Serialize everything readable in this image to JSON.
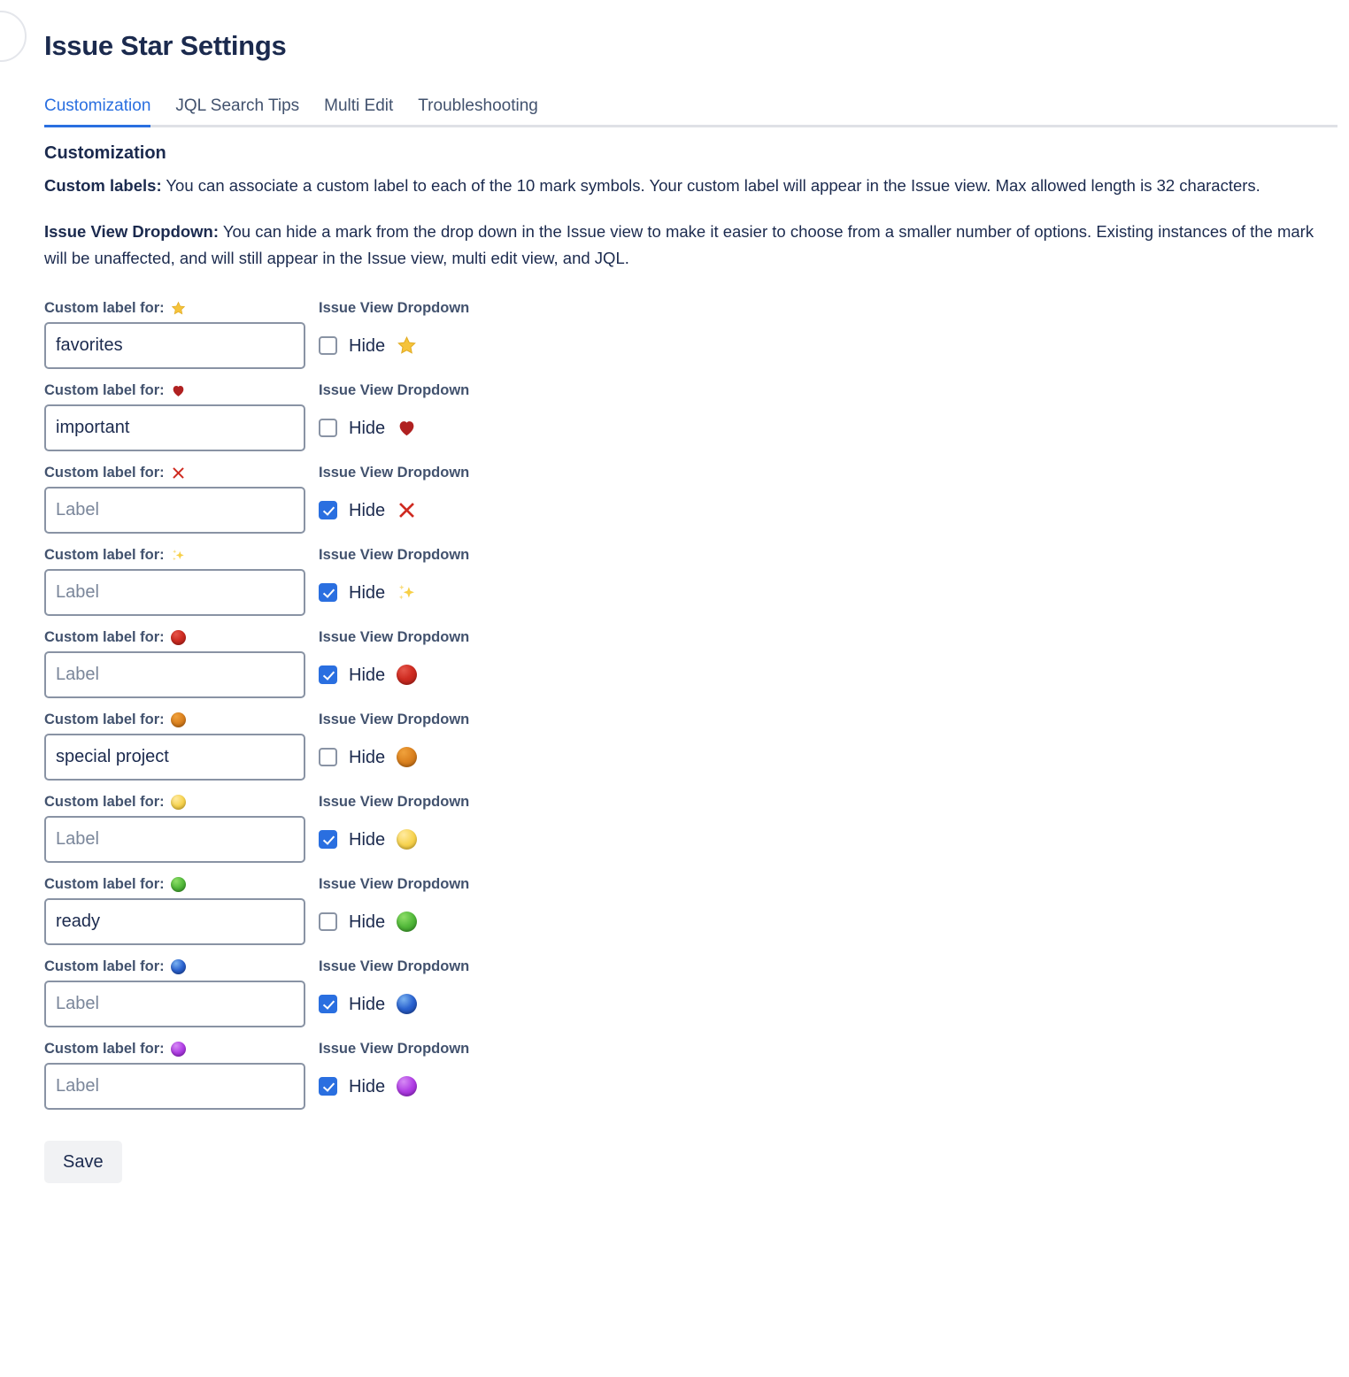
{
  "page": {
    "title": "Issue Star Settings",
    "section_heading": "Customization",
    "save_label": "Save"
  },
  "tabs": [
    {
      "label": "Customization",
      "active": true
    },
    {
      "label": "JQL Search Tips",
      "active": false
    },
    {
      "label": "Multi Edit",
      "active": false
    },
    {
      "label": "Troubleshooting",
      "active": false
    }
  ],
  "descriptions": [
    {
      "lead": "Custom labels:",
      "body": " You can associate a custom label to each of the 10 mark symbols. Your custom label will appear in the Issue view. Max allowed length is 32 characters."
    },
    {
      "lead": "Issue View Dropdown:",
      "body": " You can hide a mark from the drop down in the Issue view to make it easier to choose from a smaller number of options. Existing instances of the mark will be unaffected, and will still appear in the Issue view, multi edit view, and JQL."
    }
  ],
  "labels": {
    "custom_label_for": "Custom label for:",
    "issue_view_dropdown": "Issue View Dropdown",
    "hide": "Hide",
    "input_placeholder": "Label"
  },
  "colors": {
    "accent": "#2a6fe0",
    "text": "#1b2a4e",
    "muted_text": "#42526e",
    "border": "#8993a4",
    "tab_border": "#dfe1e6",
    "button_bg": "#f1f2f4"
  },
  "marks": [
    {
      "icon": "star-icon",
      "symbol": "star",
      "value": "favorites",
      "placeholder": "",
      "hidden": false
    },
    {
      "icon": "heart-icon",
      "symbol": "heart",
      "value": "important",
      "placeholder": "",
      "hidden": false
    },
    {
      "icon": "cross-mark-icon",
      "symbol": "x",
      "value": "",
      "placeholder": "Label",
      "hidden": true
    },
    {
      "icon": "sparkles-icon",
      "symbol": "spark",
      "value": "",
      "placeholder": "Label",
      "hidden": true
    },
    {
      "icon": "red-circle-icon",
      "symbol": "red",
      "value": "",
      "placeholder": "Label",
      "hidden": true
    },
    {
      "icon": "orange-circle-icon",
      "symbol": "orange",
      "value": "special project",
      "placeholder": "",
      "hidden": false
    },
    {
      "icon": "yellow-circle-icon",
      "symbol": "yellow",
      "value": "",
      "placeholder": "Label",
      "hidden": true
    },
    {
      "icon": "green-circle-icon",
      "symbol": "green",
      "value": "ready",
      "placeholder": "",
      "hidden": false
    },
    {
      "icon": "blue-circle-icon",
      "symbol": "blue",
      "value": "",
      "placeholder": "Label",
      "hidden": true
    },
    {
      "icon": "purple-circle-icon",
      "symbol": "purple",
      "value": "",
      "placeholder": "Label",
      "hidden": true
    }
  ]
}
